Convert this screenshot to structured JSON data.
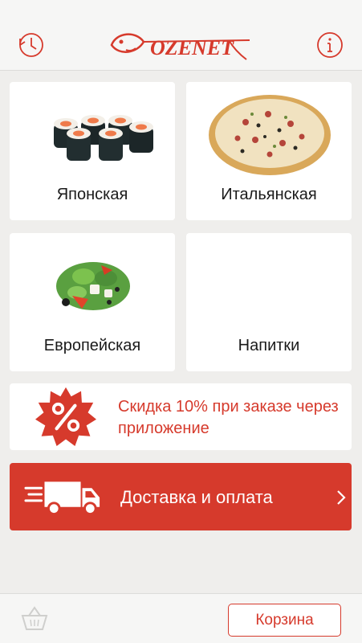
{
  "header": {
    "logo_text": "OZENET",
    "history_icon": "history-icon",
    "info_icon": "info-icon"
  },
  "categories": [
    {
      "label": "Японская",
      "image": "sushi-rolls"
    },
    {
      "label": "Итальянская",
      "image": "pizza"
    },
    {
      "label": "Европейская",
      "image": "salad"
    },
    {
      "label": "Напитки",
      "image": ""
    }
  ],
  "promo": {
    "badge_icon": "percent-badge-icon",
    "text": "Скидка 10% при заказе через приложение"
  },
  "delivery": {
    "icon": "delivery-truck-icon",
    "label": "Доставка и оплата",
    "chevron_icon": "chevron-right-icon"
  },
  "footer": {
    "basket_icon": "basket-icon",
    "cart_label": "Корзина"
  },
  "colors": {
    "accent": "#d63a2c",
    "background": "#efeeec",
    "tile": "#ffffff"
  }
}
